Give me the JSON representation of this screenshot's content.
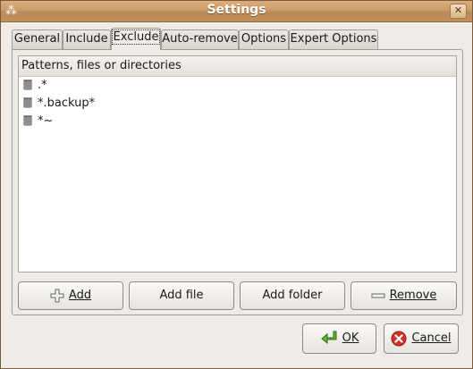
{
  "window": {
    "title": "Settings"
  },
  "tabs": [
    {
      "label": "General"
    },
    {
      "label": "Include"
    },
    {
      "label": "Exclude"
    },
    {
      "label": "Auto-remove"
    },
    {
      "label": "Options"
    },
    {
      "label": "Expert Options"
    }
  ],
  "active_tab": "Exclude",
  "list": {
    "header": "Patterns, files or directories",
    "items": [
      {
        "label": ".*",
        "icon": "trash-can-icon"
      },
      {
        "label": "*.backup*",
        "icon": "trash-can-icon"
      },
      {
        "label": "*~",
        "icon": "trash-can-icon"
      }
    ]
  },
  "buttons": {
    "add": "Add",
    "add_file": "Add file",
    "add_folder": "Add folder",
    "remove": "Remove",
    "ok": "OK",
    "cancel": "Cancel"
  },
  "colors": {
    "titlebar": "#c89a68",
    "window_bg": "#efebe7",
    "ok_arrow": "#4a9c2a",
    "cancel_red": "#d0312d"
  }
}
